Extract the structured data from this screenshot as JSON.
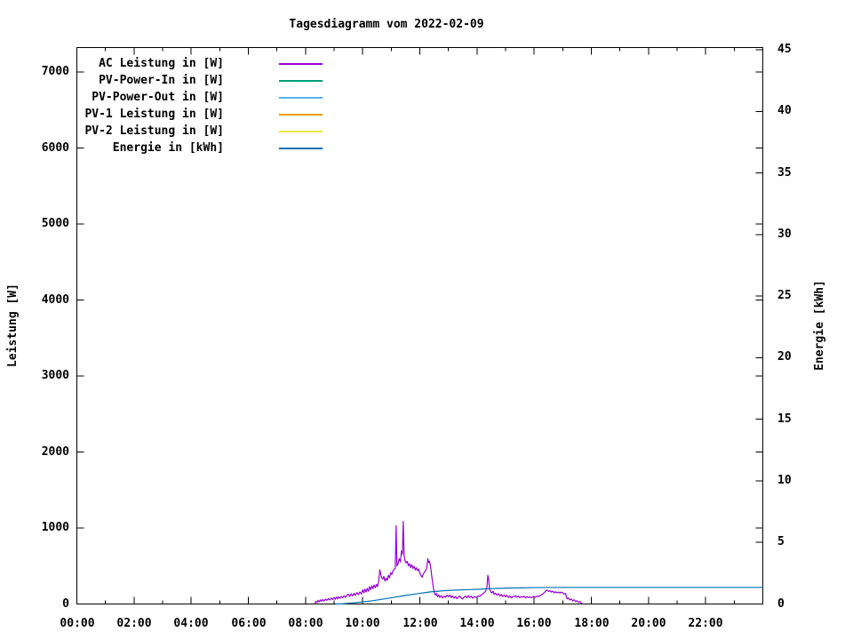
{
  "title": "Tagesdiagramm vom 2022-02-09",
  "axes": {
    "left": {
      "label": "Leistung [W]",
      "ticks": [
        0,
        1000,
        2000,
        3000,
        4000,
        5000,
        6000,
        7000
      ]
    },
    "right": {
      "label": "Energie [kWh]",
      "ticks": [
        0,
        5,
        10,
        15,
        20,
        25,
        30,
        35,
        40,
        45
      ]
    },
    "x": {
      "major_ticks": [
        {
          "h": 0,
          "label": "00:00"
        },
        {
          "h": 2,
          "label": "02:00"
        },
        {
          "h": 4,
          "label": "04:00"
        },
        {
          "h": 6,
          "label": "06:00"
        },
        {
          "h": 8,
          "label": "08:00"
        },
        {
          "h": 10,
          "label": "10:00"
        },
        {
          "h": 12,
          "label": "12:00"
        },
        {
          "h": 14,
          "label": "14:00"
        },
        {
          "h": 16,
          "label": "16:00"
        },
        {
          "h": 18,
          "label": "18:00"
        },
        {
          "h": 20,
          "label": "20:00"
        },
        {
          "h": 22,
          "label": "22:00"
        }
      ]
    }
  },
  "chart_data": {
    "type": "line",
    "title": "Tagesdiagramm vom 2022-02-09",
    "x_unit": "time of day [hours]",
    "x_range": [
      0,
      24
    ],
    "left_axis": {
      "label": "Leistung [W]",
      "range": [
        0,
        7330
      ],
      "tick_step": 1000
    },
    "right_axis": {
      "label": "Energie [kWh]",
      "range": [
        0,
        45.2
      ],
      "tick_step": 5
    },
    "grid": false,
    "legend_position": "top-left-inside",
    "series": [
      {
        "name": "AC Leistung in [W]",
        "color": "#9400d3",
        "axis": "left",
        "points": [
          [
            8.33,
            8
          ],
          [
            8.36,
            35
          ],
          [
            8.4,
            18
          ],
          [
            8.44,
            48
          ],
          [
            8.48,
            28
          ],
          [
            8.52,
            55
          ],
          [
            8.56,
            36
          ],
          [
            8.6,
            60
          ],
          [
            8.65,
            40
          ],
          [
            8.7,
            65
          ],
          [
            8.75,
            48
          ],
          [
            8.8,
            72
          ],
          [
            8.85,
            52
          ],
          [
            8.9,
            78
          ],
          [
            8.95,
            58
          ],
          [
            9.0,
            85
          ],
          [
            9.04,
            62
          ],
          [
            9.08,
            92
          ],
          [
            9.12,
            68
          ],
          [
            9.16,
            95
          ],
          [
            9.2,
            75
          ],
          [
            9.25,
            100
          ],
          [
            9.3,
            80
          ],
          [
            9.35,
            108
          ],
          [
            9.4,
            86
          ],
          [
            9.45,
            118
          ],
          [
            9.5,
            128
          ],
          [
            9.55,
            98
          ],
          [
            9.6,
            135
          ],
          [
            9.65,
            106
          ],
          [
            9.7,
            142
          ],
          [
            9.75,
            114
          ],
          [
            9.8,
            150
          ],
          [
            9.85,
            124
          ],
          [
            9.9,
            158
          ],
          [
            9.95,
            132
          ],
          [
            10.0,
            185
          ],
          [
            10.04,
            146
          ],
          [
            10.08,
            195
          ],
          [
            10.12,
            158
          ],
          [
            10.16,
            205
          ],
          [
            10.2,
            168
          ],
          [
            10.24,
            228
          ],
          [
            10.28,
            188
          ],
          [
            10.32,
            240
          ],
          [
            10.36,
            202
          ],
          [
            10.4,
            250
          ],
          [
            10.44,
            214
          ],
          [
            10.48,
            258
          ],
          [
            10.52,
            230
          ],
          [
            10.56,
            300
          ],
          [
            10.6,
            450
          ],
          [
            10.63,
            400
          ],
          [
            10.66,
            348
          ],
          [
            10.7,
            328
          ],
          [
            10.74,
            362
          ],
          [
            10.78,
            302
          ],
          [
            10.82,
            340
          ],
          [
            10.86,
            310
          ],
          [
            10.9,
            378
          ],
          [
            10.94,
            344
          ],
          [
            10.98,
            412
          ],
          [
            11.02,
            388
          ],
          [
            11.06,
            438
          ],
          [
            11.1,
            455
          ],
          [
            11.14,
            470
          ],
          [
            11.17,
            1030
          ],
          [
            11.2,
            500
          ],
          [
            11.24,
            530
          ],
          [
            11.28,
            598
          ],
          [
            11.32,
            552
          ],
          [
            11.36,
            700
          ],
          [
            11.39,
            655
          ],
          [
            11.42,
            1085
          ],
          [
            11.45,
            640
          ],
          [
            11.48,
            575
          ],
          [
            11.52,
            540
          ],
          [
            11.56,
            562
          ],
          [
            11.6,
            502
          ],
          [
            11.64,
            532
          ],
          [
            11.68,
            478
          ],
          [
            11.72,
            518
          ],
          [
            11.76,
            468
          ],
          [
            11.8,
            496
          ],
          [
            11.84,
            448
          ],
          [
            11.88,
            476
          ],
          [
            11.92,
            438
          ],
          [
            11.96,
            460
          ],
          [
            12.0,
            406
          ],
          [
            12.04,
            378
          ],
          [
            12.08,
            352
          ],
          [
            12.12,
            392
          ],
          [
            12.16,
            418
          ],
          [
            12.2,
            442
          ],
          [
            12.24,
            468
          ],
          [
            12.28,
            595
          ],
          [
            12.31,
            545
          ],
          [
            12.34,
            562
          ],
          [
            12.38,
            478
          ],
          [
            12.42,
            358
          ],
          [
            12.46,
            248
          ],
          [
            12.5,
            158
          ],
          [
            12.54,
            118
          ],
          [
            12.58,
            140
          ],
          [
            12.62,
            96
          ],
          [
            12.66,
            120
          ],
          [
            12.7,
            86
          ],
          [
            12.75,
            110
          ],
          [
            12.8,
            80
          ],
          [
            12.85,
            104
          ],
          [
            12.9,
            88
          ],
          [
            12.95,
            116
          ],
          [
            13.0,
            94
          ],
          [
            13.05,
            118
          ],
          [
            13.1,
            84
          ],
          [
            13.15,
            106
          ],
          [
            13.2,
            76
          ],
          [
            13.25,
            100
          ],
          [
            13.3,
            70
          ],
          [
            13.35,
            94
          ],
          [
            13.4,
            104
          ],
          [
            13.45,
            78
          ],
          [
            13.5,
            68
          ],
          [
            13.55,
            90
          ],
          [
            13.6,
            106
          ],
          [
            13.65,
            82
          ],
          [
            13.7,
            110
          ],
          [
            13.75,
            86
          ],
          [
            13.8,
            102
          ],
          [
            13.85,
            76
          ],
          [
            13.9,
            98
          ],
          [
            13.95,
            90
          ],
          [
            14.0,
            94
          ],
          [
            14.05,
            108
          ],
          [
            14.1,
            100
          ],
          [
            14.15,
            120
          ],
          [
            14.2,
            132
          ],
          [
            14.25,
            150
          ],
          [
            14.3,
            165
          ],
          [
            14.35,
            228
          ],
          [
            14.38,
            378
          ],
          [
            14.41,
            318
          ],
          [
            14.44,
            198
          ],
          [
            14.48,
            160
          ],
          [
            14.52,
            146
          ],
          [
            14.56,
            168
          ],
          [
            14.6,
            126
          ],
          [
            14.65,
            142
          ],
          [
            14.7,
            116
          ],
          [
            14.75,
            136
          ],
          [
            14.8,
            106
          ],
          [
            14.85,
            126
          ],
          [
            14.9,
            98
          ],
          [
            14.95,
            118
          ],
          [
            15.0,
            94
          ],
          [
            15.05,
            114
          ],
          [
            15.1,
            86
          ],
          [
            15.15,
            106
          ],
          [
            15.2,
            80
          ],
          [
            15.25,
            100
          ],
          [
            15.3,
            94
          ],
          [
            15.35,
            110
          ],
          [
            15.4,
            88
          ],
          [
            15.45,
            104
          ],
          [
            15.5,
            84
          ],
          [
            15.55,
            98
          ],
          [
            15.6,
            90
          ],
          [
            15.65,
            102
          ],
          [
            15.7,
            80
          ],
          [
            15.75,
            96
          ],
          [
            15.8,
            86
          ],
          [
            15.85,
            94
          ],
          [
            15.9,
            82
          ],
          [
            15.95,
            92
          ],
          [
            16.0,
            98
          ],
          [
            16.05,
            90
          ],
          [
            16.1,
            104
          ],
          [
            16.15,
            96
          ],
          [
            16.2,
            110
          ],
          [
            16.25,
            118
          ],
          [
            16.3,
            132
          ],
          [
            16.35,
            148
          ],
          [
            16.4,
            170
          ],
          [
            16.45,
            184
          ],
          [
            16.5,
            166
          ],
          [
            16.55,
            176
          ],
          [
            16.6,
            156
          ],
          [
            16.65,
            170
          ],
          [
            16.7,
            148
          ],
          [
            16.75,
            162
          ],
          [
            16.8,
            146
          ],
          [
            16.85,
            158
          ],
          [
            16.9,
            144
          ],
          [
            16.95,
            156
          ],
          [
            17.0,
            148
          ],
          [
            17.05,
            130
          ],
          [
            17.1,
            138
          ],
          [
            17.15,
            68
          ],
          [
            17.2,
            80
          ],
          [
            17.25,
            54
          ],
          [
            17.3,
            66
          ],
          [
            17.35,
            40
          ],
          [
            17.4,
            56
          ],
          [
            17.45,
            30
          ],
          [
            17.5,
            44
          ],
          [
            17.55,
            20
          ],
          [
            17.6,
            32
          ],
          [
            17.65,
            10
          ],
          [
            17.7,
            3
          ]
        ]
      },
      {
        "name": "PV-Power-In in [W]",
        "color": "#009e73",
        "axis": "left",
        "points": []
      },
      {
        "name": "PV-Power-Out in [W]",
        "color": "#56b4e9",
        "axis": "left",
        "points": []
      },
      {
        "name": "PV-1 Leistung in [W]",
        "color": "#e69f00",
        "axis": "left",
        "points": []
      },
      {
        "name": "PV-2 Leistung in [W]",
        "color": "#f0e442",
        "axis": "left",
        "points": []
      },
      {
        "name": "Energie in [kWh]",
        "color": "#0072b2",
        "axis": "right",
        "points": [
          [
            9.05,
            0.0
          ],
          [
            9.3,
            0.02
          ],
          [
            9.5,
            0.06
          ],
          [
            9.75,
            0.11
          ],
          [
            10.0,
            0.17
          ],
          [
            10.25,
            0.24
          ],
          [
            10.5,
            0.32
          ],
          [
            10.75,
            0.41
          ],
          [
            11.0,
            0.5
          ],
          [
            11.2,
            0.58
          ],
          [
            11.4,
            0.66
          ],
          [
            11.6,
            0.73
          ],
          [
            11.8,
            0.8
          ],
          [
            12.0,
            0.87
          ],
          [
            12.2,
            0.93
          ],
          [
            12.4,
            0.99
          ],
          [
            12.6,
            1.03
          ],
          [
            12.8,
            1.07
          ],
          [
            13.0,
            1.1
          ],
          [
            13.25,
            1.13
          ],
          [
            13.5,
            1.15
          ],
          [
            13.75,
            1.17
          ],
          [
            14.0,
            1.19
          ],
          [
            14.25,
            1.22
          ],
          [
            14.5,
            1.25
          ],
          [
            14.75,
            1.27
          ],
          [
            15.0,
            1.29
          ],
          [
            15.5,
            1.31
          ],
          [
            16.0,
            1.33
          ],
          [
            16.5,
            1.34
          ],
          [
            17.0,
            1.35
          ],
          [
            18.0,
            1.35
          ],
          [
            24.0,
            1.35
          ]
        ]
      }
    ]
  }
}
